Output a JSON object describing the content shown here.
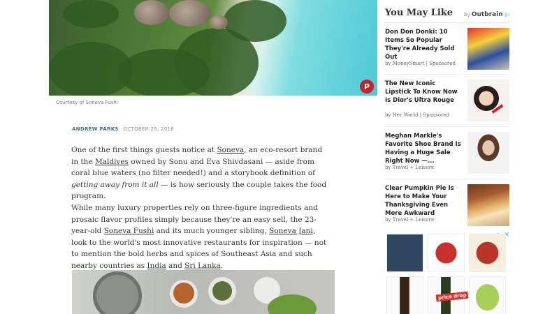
{
  "hero": {
    "caption": "Courtesy of Soneva Fushi",
    "pin_glyph": "P"
  },
  "article": {
    "author": "ANDREW PARKS",
    "date": "OCTOBER 25, 2018",
    "p1": {
      "t1": "One of the first things guests notice at ",
      "l1": "Soneva",
      "t2": ", an eco-resort brand in the ",
      "l2": "Maldives",
      "t3": " owned by Sonu and Eva Shivdasani — aside from coral blue waters (no filter needed!) and a storybook definition of ",
      "em": "getting away from it all",
      "t4": " — is how seriously the couple takes the food program."
    },
    "p2": {
      "t1": "While many luxury properties rely on three-figure ingredients and prosaic flavor profiles simply because they're an easy sell, the 23-year-old ",
      "l1": "Soneva Fushi",
      "t2": " and its much younger sibling, ",
      "l2": "Soneva Jani",
      "t3": ", look to the world's most innovative restaurants for inspiration — not to mention the bold herbs and spices of Southeast Asia and such nearby countries as ",
      "l3": "India",
      "t4": " and ",
      "l4": "Sri Lanka",
      "t5": "."
    }
  },
  "sidebar": {
    "title": "You May Like",
    "by": "by",
    "brand": "Outbrain",
    "recs": [
      {
        "title": "Don Don Donki: 10 Items So Popular They're Already Sold Out",
        "source": "by MoneySmart | Sponsored"
      },
      {
        "title": "The New Iconic Lipstick To Know Now Is Dior's Ultra Rouge",
        "source": "by Her World | Sponsored"
      },
      {
        "title": "Meghan Markle's Favorite Shoe Brand Is Having a Huge Sale Right Now —...",
        "source": "by Travel + Leisure"
      },
      {
        "title": "Clear Pumpkin Pie Is Here to Make Your Thanksgiving Even More Awkward",
        "source": "by Travel + Leisure"
      }
    ]
  },
  "ad": {
    "close": "✕",
    "info": "▷",
    "badge": "price drop"
  },
  "colors": {
    "link": "#3d6f8f",
    "pinterest": "#c8232c",
    "adchoice": "#2aa9e0"
  }
}
